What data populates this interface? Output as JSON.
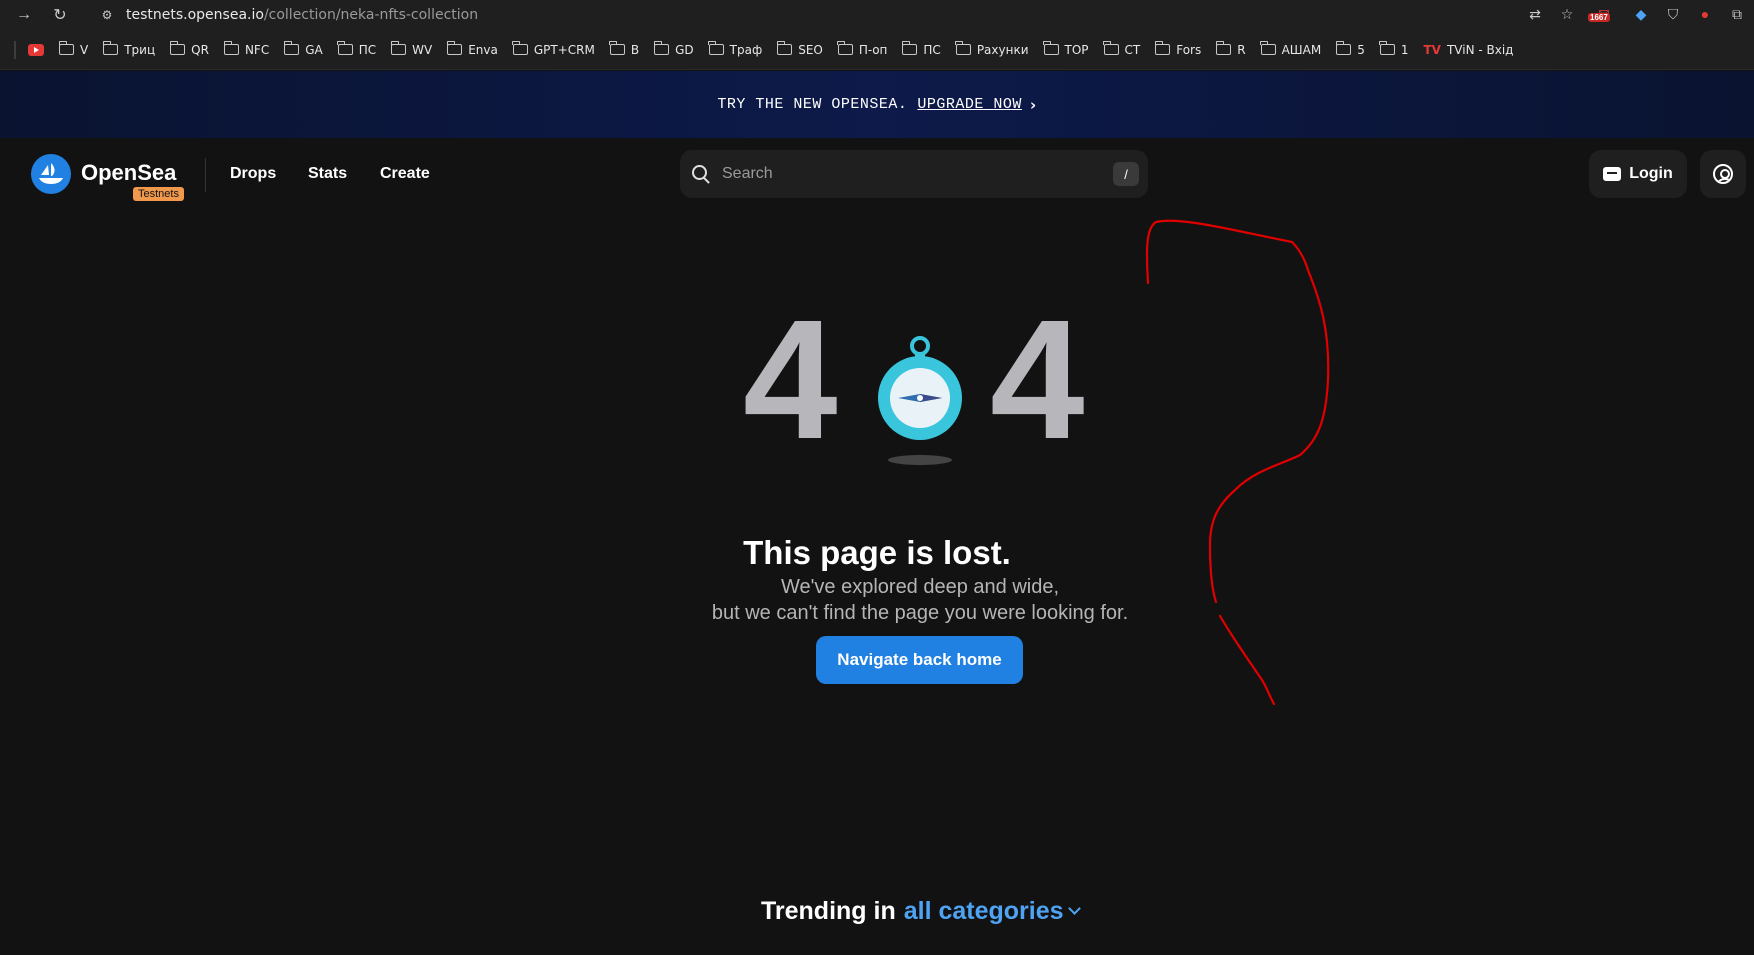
{
  "browser": {
    "url_host": "testnets.opensea.io",
    "url_path": "/collection/neka-nfts-collection",
    "extension_badge": "1667",
    "bookmarks": [
      "V",
      "Триц",
      "QR",
      "NFC",
      "GA",
      "ПС",
      "WV",
      "Enva",
      "GPT+CRM",
      "B",
      "GD",
      "Траф",
      "SEO",
      "П-оп",
      "ПС",
      "Рахунки",
      "TOP",
      "СТ",
      "Fors",
      "R",
      "АШАМ",
      "5",
      "1"
    ],
    "last_bookmark": "TViN - Вхід"
  },
  "promo": {
    "text": "TRY THE NEW OPENSEA.",
    "link": "UPGRADE NOW"
  },
  "header": {
    "brand": "OpenSea",
    "env_badge": "Testnets",
    "nav": [
      "Drops",
      "Stats",
      "Create"
    ],
    "search_placeholder": "Search",
    "search_shortcut": "/",
    "login_label": "Login"
  },
  "error": {
    "code_left": "4",
    "code_right": "4",
    "title": "This page is lost.",
    "line1": "We've explored deep and wide,",
    "line2": "but we can't find the page you were looking for.",
    "button": "Navigate back home"
  },
  "trending": {
    "prefix": "Trending in",
    "category": "all categories"
  },
  "colors": {
    "accent": "#2081e2",
    "background": "#121212",
    "badge": "#f0994c",
    "annotation": "#e00000"
  }
}
